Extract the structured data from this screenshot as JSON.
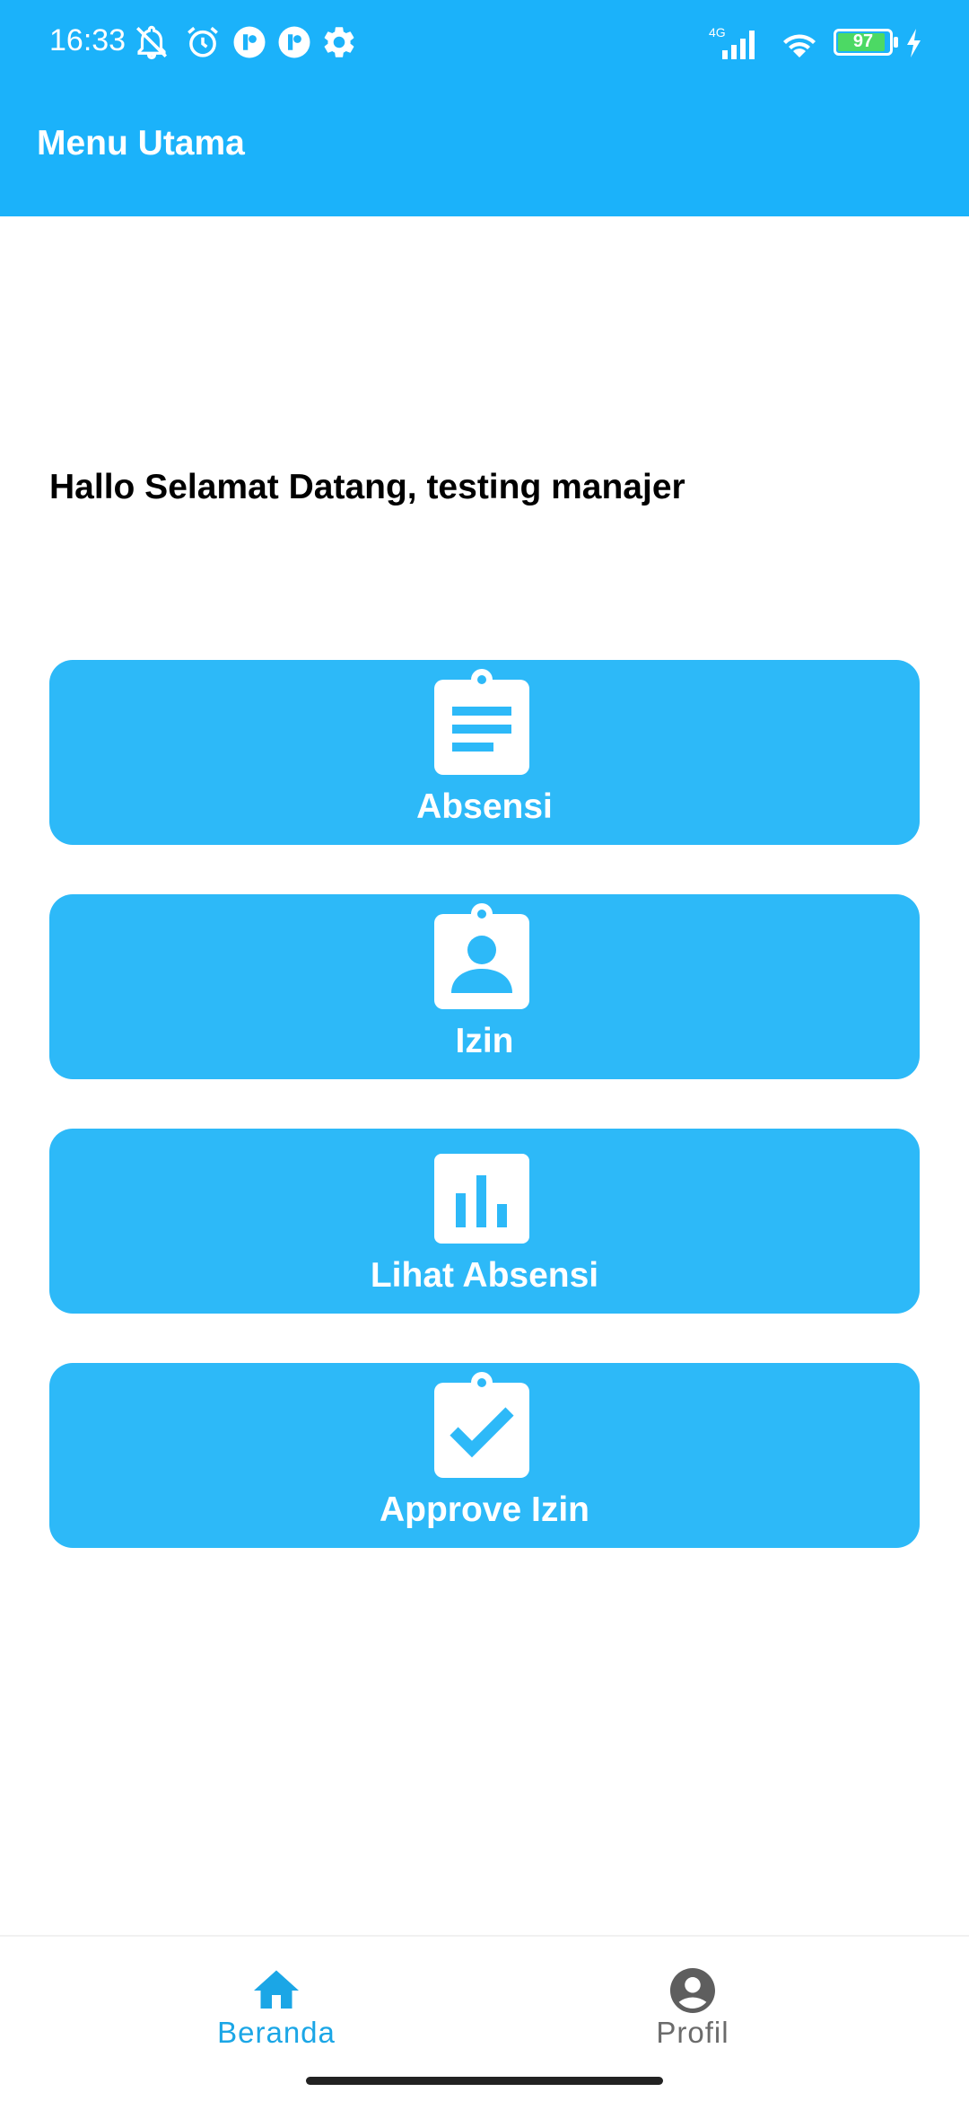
{
  "status_bar": {
    "time": "16:33",
    "network": "4G",
    "battery": "97",
    "icons": [
      "mute-icon",
      "alarm-icon",
      "app-icon",
      "app-icon",
      "settings-icon",
      "signal-icon",
      "wifi-icon",
      "battery-icon",
      "charging-icon"
    ]
  },
  "appbar": {
    "title": "Menu Utama",
    "color": "#1BB2FA"
  },
  "greeting": "Hallo Selamat Datang, testing manajer",
  "menu": [
    {
      "label": "Absensi",
      "icon": "clipboard-list-icon"
    },
    {
      "label": "Izin",
      "icon": "clipboard-person-icon"
    },
    {
      "label": "Lihat Absensi",
      "icon": "bar-chart-icon"
    },
    {
      "label": "Approve Izin",
      "icon": "clipboard-check-icon"
    }
  ],
  "bottom_nav": {
    "items": [
      {
        "label": "Beranda",
        "icon": "home-icon",
        "active": true,
        "color": "#1BA6E6"
      },
      {
        "label": "Profil",
        "icon": "account-circle-icon",
        "active": false,
        "color": "#6B6B6B"
      }
    ]
  }
}
